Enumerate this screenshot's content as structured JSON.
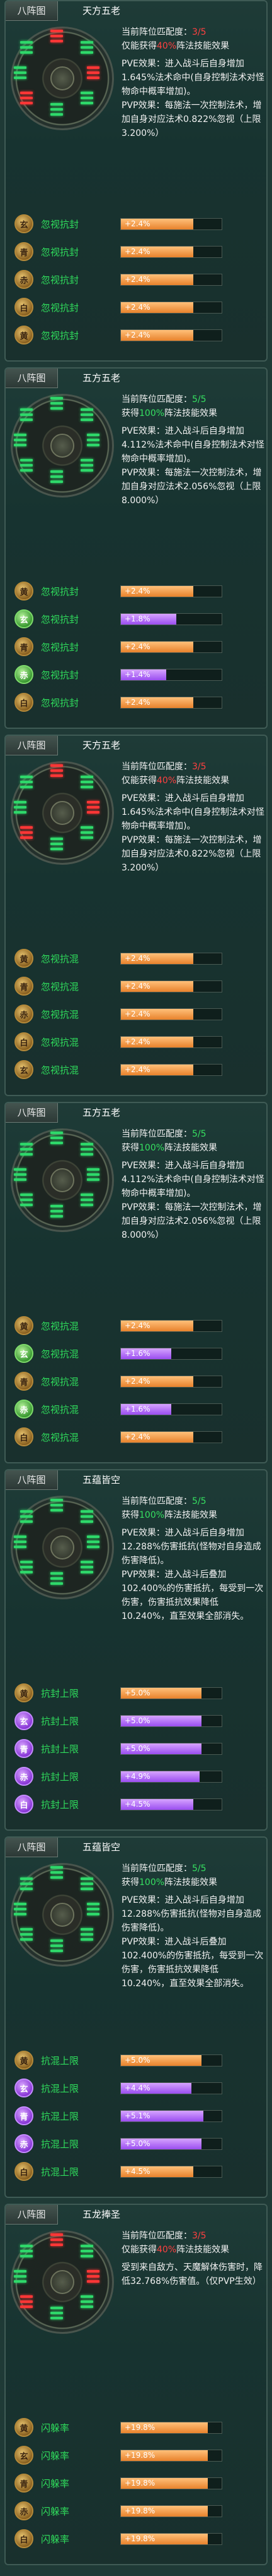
{
  "panels": [
    {
      "tag": "八阵图",
      "name": "天方五老",
      "wheel": [
        "red",
        "green",
        "red",
        "green",
        "green",
        "red",
        "green",
        "green"
      ],
      "lines": [
        {
          "text": "当前阵位匹配度：",
          "v": "3/5",
          "vc": "red"
        },
        {
          "text": "仅能获得",
          "v": "40%",
          "vc": "red",
          "after": "阵法技能效果"
        }
      ],
      "body": "PVE效果：进入战斗后自身增加1.645%法术命中(自身控制法术对怪物命中概率增加)。\nPVP效果：每施法一次控制法术，增加自身对应法术0.822%忽视（上限3.200%）",
      "rows": [
        {
          "gem": "玄",
          "color": "gold",
          "label": "忽视抗封",
          "value": "+2.4%",
          "fill": 0.72,
          "bar": "orange"
        },
        {
          "gem": "青",
          "color": "gold",
          "label": "忽视抗封",
          "value": "+2.4%",
          "fill": 0.72,
          "bar": "orange"
        },
        {
          "gem": "赤",
          "color": "gold",
          "label": "忽视抗封",
          "value": "+2.4%",
          "fill": 0.72,
          "bar": "orange"
        },
        {
          "gem": "白",
          "color": "gold",
          "label": "忽视抗封",
          "value": "+2.4%",
          "fill": 0.72,
          "bar": "orange"
        },
        {
          "gem": "黄",
          "color": "gold",
          "label": "忽视抗封",
          "value": "+2.4%",
          "fill": 0.72,
          "bar": "orange"
        }
      ]
    },
    {
      "tag": "八阵图",
      "name": "五方五老",
      "wheel": [
        "green",
        "green",
        "green",
        "green",
        "green",
        "green",
        "green",
        "green"
      ],
      "lines": [
        {
          "text": "当前阵位匹配度：",
          "v": "5/5",
          "vc": "green"
        },
        {
          "text": "获得",
          "v": "100%",
          "vc": "green",
          "after": "阵法技能效果"
        }
      ],
      "body": "PVE效果：进入战斗后自身增加4.112%法术命中(自身控制法术对怪物命中概率增加)。\nPVP效果：每施法一次控制法术，增加自身对应法术2.056%忽视（上限8.000%）",
      "rows": [
        {
          "gem": "黄",
          "color": "gold",
          "label": "忽视抗封",
          "value": "+2.4%",
          "fill": 0.72,
          "bar": "orange"
        },
        {
          "gem": "玄",
          "color": "green",
          "label": "忽视抗封",
          "value": "+1.8%",
          "fill": 0.55,
          "bar": "purple"
        },
        {
          "gem": "青",
          "color": "gold",
          "label": "忽视抗封",
          "value": "+2.4%",
          "fill": 0.72,
          "bar": "orange"
        },
        {
          "gem": "赤",
          "color": "green",
          "label": "忽视抗封",
          "value": "+1.4%",
          "fill": 0.45,
          "bar": "purple"
        },
        {
          "gem": "白",
          "color": "gold",
          "label": "忽视抗封",
          "value": "+2.4%",
          "fill": 0.72,
          "bar": "orange"
        }
      ]
    },
    {
      "tag": "八阵图",
      "name": "天方五老",
      "wheel": [
        "red",
        "green",
        "red",
        "green",
        "green",
        "red",
        "green",
        "green"
      ],
      "lines": [
        {
          "text": "当前阵位匹配度：",
          "v": "3/5",
          "vc": "red"
        },
        {
          "text": "仅能获得",
          "v": "40%",
          "vc": "red",
          "after": "阵法技能效果"
        }
      ],
      "body": "PVE效果：进入战斗后自身增加1.645%法术命中(自身控制法术对怪物命中概率增加)。\nPVP效果：每施法一次控制法术，增加自身对应法术0.822%忽视（上限3.200%）",
      "rows": [
        {
          "gem": "黄",
          "color": "gold",
          "label": "忽视抗混",
          "value": "+2.4%",
          "fill": 0.72,
          "bar": "orange"
        },
        {
          "gem": "青",
          "color": "gold",
          "label": "忽视抗混",
          "value": "+2.4%",
          "fill": 0.72,
          "bar": "orange"
        },
        {
          "gem": "赤",
          "color": "gold",
          "label": "忽视抗混",
          "value": "+2.4%",
          "fill": 0.72,
          "bar": "orange"
        },
        {
          "gem": "白",
          "color": "gold",
          "label": "忽视抗混",
          "value": "+2.4%",
          "fill": 0.72,
          "bar": "orange"
        },
        {
          "gem": "玄",
          "color": "gold",
          "label": "忽视抗混",
          "value": "+2.4%",
          "fill": 0.72,
          "bar": "orange"
        }
      ]
    },
    {
      "tag": "八阵图",
      "name": "五方五老",
      "wheel": [
        "green",
        "green",
        "green",
        "green",
        "green",
        "green",
        "green",
        "green"
      ],
      "lines": [
        {
          "text": "当前阵位匹配度：",
          "v": "5/5",
          "vc": "green"
        },
        {
          "text": "获得",
          "v": "100%",
          "vc": "green",
          "after": "阵法技能效果"
        }
      ],
      "body": "PVE效果：进入战斗后自身增加4.112%法术命中(自身控制法术对怪物命中概率增加)。\nPVP效果：每施法一次控制法术，增加自身对应法术2.056%忽视（上限8.000%）",
      "rows": [
        {
          "gem": "黄",
          "color": "gold",
          "label": "忽视抗混",
          "value": "+2.4%",
          "fill": 0.72,
          "bar": "orange"
        },
        {
          "gem": "玄",
          "color": "green",
          "label": "忽视抗混",
          "value": "+1.6%",
          "fill": 0.5,
          "bar": "purple"
        },
        {
          "gem": "青",
          "color": "gold",
          "label": "忽视抗混",
          "value": "+2.4%",
          "fill": 0.72,
          "bar": "orange"
        },
        {
          "gem": "赤",
          "color": "green",
          "label": "忽视抗混",
          "value": "+1.6%",
          "fill": 0.5,
          "bar": "purple"
        },
        {
          "gem": "白",
          "color": "gold",
          "label": "忽视抗混",
          "value": "+2.4%",
          "fill": 0.72,
          "bar": "orange"
        }
      ]
    },
    {
      "tag": "八阵图",
      "name": "五蕴皆空",
      "wheel": [
        "green",
        "green",
        "green",
        "green",
        "green",
        "green",
        "green",
        "green"
      ],
      "lines": [
        {
          "text": "当前阵位匹配度：",
          "v": "5/5",
          "vc": "green"
        },
        {
          "text": "获得",
          "v": "100%",
          "vc": "green",
          "after": "阵法技能效果"
        }
      ],
      "body": "PVE效果：进入战斗后自身增加12.288%伤害抵抗(怪物对自身造成伤害降低)。\nPVP效果：进入战斗后叠加102.400%的伤害抵抗，每受到一次伤害，伤害抵抗效果降低10.240%，直至效果全部消失。",
      "rows": [
        {
          "gem": "黄",
          "color": "gold",
          "label": "抗封上限",
          "value": "+5.0%",
          "fill": 0.8,
          "bar": "orange"
        },
        {
          "gem": "玄",
          "color": "purple",
          "label": "抗封上限",
          "value": "+5.0%",
          "fill": 0.8,
          "bar": "purple"
        },
        {
          "gem": "青",
          "color": "purple",
          "label": "抗封上限",
          "value": "+5.0%",
          "fill": 0.8,
          "bar": "purple"
        },
        {
          "gem": "赤",
          "color": "purple",
          "label": "抗封上限",
          "value": "+4.9%",
          "fill": 0.78,
          "bar": "purple"
        },
        {
          "gem": "白",
          "color": "purple",
          "label": "抗封上限",
          "value": "+4.5%",
          "fill": 0.72,
          "bar": "purple"
        }
      ]
    },
    {
      "tag": "八阵图",
      "name": "五蕴皆空",
      "wheel": [
        "green",
        "green",
        "green",
        "green",
        "green",
        "green",
        "green",
        "green"
      ],
      "lines": [
        {
          "text": "当前阵位匹配度：",
          "v": "5/5",
          "vc": "green"
        },
        {
          "text": "获得",
          "v": "100%",
          "vc": "green",
          "after": "阵法技能效果"
        }
      ],
      "body": "PVE效果：进入战斗后自身增加12.288%伤害抵抗(怪物对自身造成伤害降低)。\nPVP效果：进入战斗后叠加102.400%的伤害抵抗，每受到一次伤害，伤害抵抗效果降低10.240%，直至效果全部消失。",
      "rows": [
        {
          "gem": "黄",
          "color": "gold",
          "label": "抗混上限",
          "value": "+5.0%",
          "fill": 0.8,
          "bar": "orange"
        },
        {
          "gem": "玄",
          "color": "purple",
          "label": "抗混上限",
          "value": "+4.4%",
          "fill": 0.7,
          "bar": "purple"
        },
        {
          "gem": "青",
          "color": "purple",
          "label": "抗混上限",
          "value": "+5.1%",
          "fill": 0.82,
          "bar": "purple"
        },
        {
          "gem": "赤",
          "color": "purple",
          "label": "抗混上限",
          "value": "+5.0%",
          "fill": 0.8,
          "bar": "purple"
        },
        {
          "gem": "白",
          "color": "gold",
          "label": "抗混上限",
          "value": "+4.5%",
          "fill": 0.72,
          "bar": "orange"
        }
      ]
    },
    {
      "tag": "八阵图",
      "name": "五龙捧圣",
      "wheel": [
        "red",
        "green",
        "red",
        "green",
        "green",
        "red",
        "green",
        "green"
      ],
      "lines": [
        {
          "text": "当前阵位匹配度：",
          "v": "3/5",
          "vc": "red"
        },
        {
          "text": "仅能获得",
          "v": "40%",
          "vc": "red",
          "after": "阵法技能效果"
        }
      ],
      "body": "受到来自敌方、天魔解体伤害时，降低32.768%伤害值。（仅PVP生效）",
      "rows": [
        {
          "gem": "黄",
          "color": "gold",
          "label": "闪躲率",
          "value": "+19.8%",
          "fill": 0.86,
          "bar": "orange"
        },
        {
          "gem": "玄",
          "color": "gold",
          "label": "闪躲率",
          "value": "+19.8%",
          "fill": 0.86,
          "bar": "orange"
        },
        {
          "gem": "青",
          "color": "gold",
          "label": "闪躲率",
          "value": "+19.8%",
          "fill": 0.86,
          "bar": "orange"
        },
        {
          "gem": "赤",
          "color": "gold",
          "label": "闪躲率",
          "value": "+19.8%",
          "fill": 0.86,
          "bar": "orange"
        },
        {
          "gem": "白",
          "color": "gold",
          "label": "闪躲率",
          "value": "+19.8%",
          "fill": 0.86,
          "bar": "orange"
        }
      ]
    }
  ]
}
